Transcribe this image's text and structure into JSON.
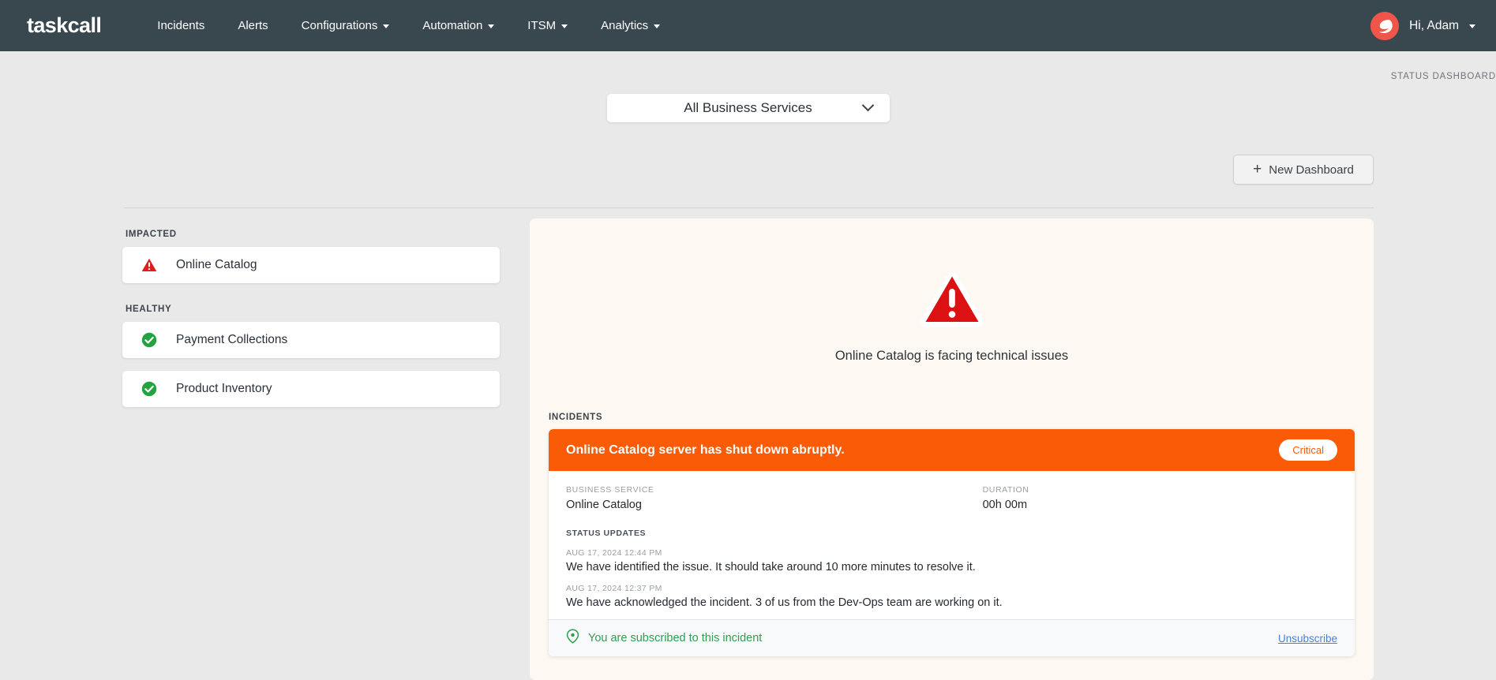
{
  "navbar": {
    "brand": "taskcall",
    "items": [
      {
        "label": "Incidents",
        "has_caret": false
      },
      {
        "label": "Alerts",
        "has_caret": false
      },
      {
        "label": "Configurations",
        "has_caret": true
      },
      {
        "label": "Automation",
        "has_caret": true
      },
      {
        "label": "ITSM",
        "has_caret": true
      },
      {
        "label": "Analytics",
        "has_caret": true
      }
    ],
    "greeting": "Hi, Adam"
  },
  "dashboard": {
    "title": "STATUS DASHBOARD",
    "selector_value": "All Business Services",
    "new_dashboard_label": "New Dashboard",
    "plus_glyph": "+"
  },
  "sidebar": {
    "impacted_label": "IMPACTED",
    "healthy_label": "HEALTHY",
    "impacted": [
      {
        "name": "Online Catalog",
        "icon": "warning-triangle-icon"
      }
    ],
    "healthy": [
      {
        "name": "Payment Collections",
        "icon": "check-circle-icon"
      },
      {
        "name": "Product Inventory",
        "icon": "check-circle-icon"
      }
    ]
  },
  "panel": {
    "hero_icon": "warning-triangle-icon",
    "hero_text": "Online Catalog is facing technical issues",
    "incidents_label": "INCIDENTS",
    "incident": {
      "title": "Online Catalog server has shut down abruptly.",
      "severity": "Critical",
      "business_service_label": "BUSINESS SERVICE",
      "business_service": "Online Catalog",
      "duration_label": "DURATION",
      "duration": "00h 00m",
      "status_updates_label": "STATUS UPDATES",
      "updates": [
        {
          "timestamp": "AUG 17, 2024 12:44 PM",
          "message": "We have identified the issue. It should take around 10 more minutes to resolve it."
        },
        {
          "timestamp": "AUG 17, 2024 12:37 PM",
          "message": "We have acknowledged the incident. 3 of us from the Dev-Ops team are working on it."
        }
      ],
      "subscribed_text": "You are subscribed to this incident",
      "unsubscribe_label": "Unsubscribe",
      "subscribe_icon": "location-pin-icon"
    }
  },
  "colors": {
    "navbar_bg": "#39474f",
    "page_bg": "#e9e9e9",
    "panel_bg": "#fdf8f1",
    "critical": "#f95b07",
    "danger": "#dc1e1e",
    "healthy": "#2e9e4f",
    "link": "#4a7fd4"
  }
}
